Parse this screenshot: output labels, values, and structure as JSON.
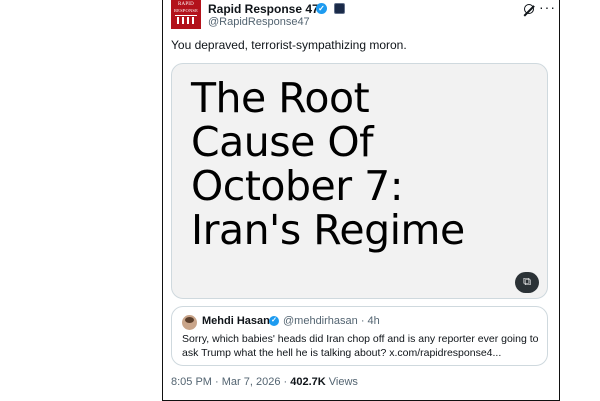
{
  "author": {
    "name": "Rapid Response 47",
    "handle": "@RapidResponse47",
    "avatar_line1": "RAPID",
    "avatar_line2": "RESPONSE"
  },
  "tweet": {
    "text": "You depraved, terrorist-sympathizing moron."
  },
  "media": {
    "title": "The Root\nCause Of\nOctober 7:\nIran's Regime"
  },
  "quoted": {
    "name": "Mehdi Hasan",
    "handle": "@mehdirhasan",
    "time": "· 4h",
    "text": "Sorry, which babies' heads did Iran chop off and is any reporter ever going to ask Trump what the hell he is talking about? x.com/rapidresponse4..."
  },
  "meta": {
    "timestamp": "8:05 PM · Mar 7, 2026 · ",
    "views_count": "402.7K",
    "views_label": " Views"
  },
  "colors": {
    "verified_blue": "#1d9bf0",
    "avatar_red": "#b3121b",
    "secondary_text": "#536471"
  },
  "icons": [
    "verified-badge-icon",
    "affiliate-badge-icon",
    "grok-icon",
    "more-icon",
    "alt-text-icon"
  ]
}
